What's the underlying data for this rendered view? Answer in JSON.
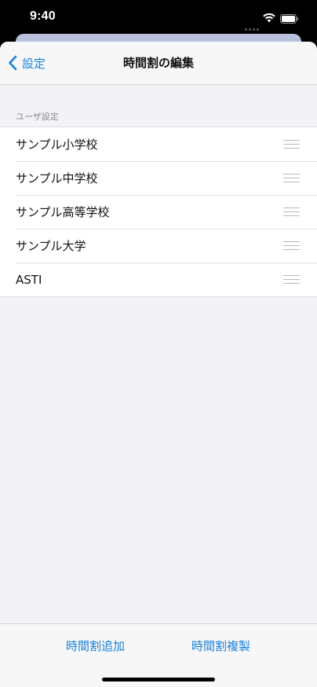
{
  "status_bar": {
    "time": "9:40",
    "icons": [
      "cellular-signal-icon",
      "wifi-icon",
      "battery-icon"
    ]
  },
  "nav": {
    "back_label": "設定",
    "title": "時間割の編集"
  },
  "section": {
    "header": "ユーザ設定"
  },
  "list": {
    "items": [
      {
        "label": "サンプル小学校"
      },
      {
        "label": "サンプル中学校"
      },
      {
        "label": "サンプル高等学校"
      },
      {
        "label": "サンプル大学"
      },
      {
        "label": "ASTI"
      }
    ]
  },
  "toolbar": {
    "add_label": "時間割追加",
    "duplicate_label": "時間割複製"
  },
  "colors": {
    "accent": "#1a82d8",
    "background": "#f2f2f7",
    "peek_card": "#b9c1dd"
  }
}
